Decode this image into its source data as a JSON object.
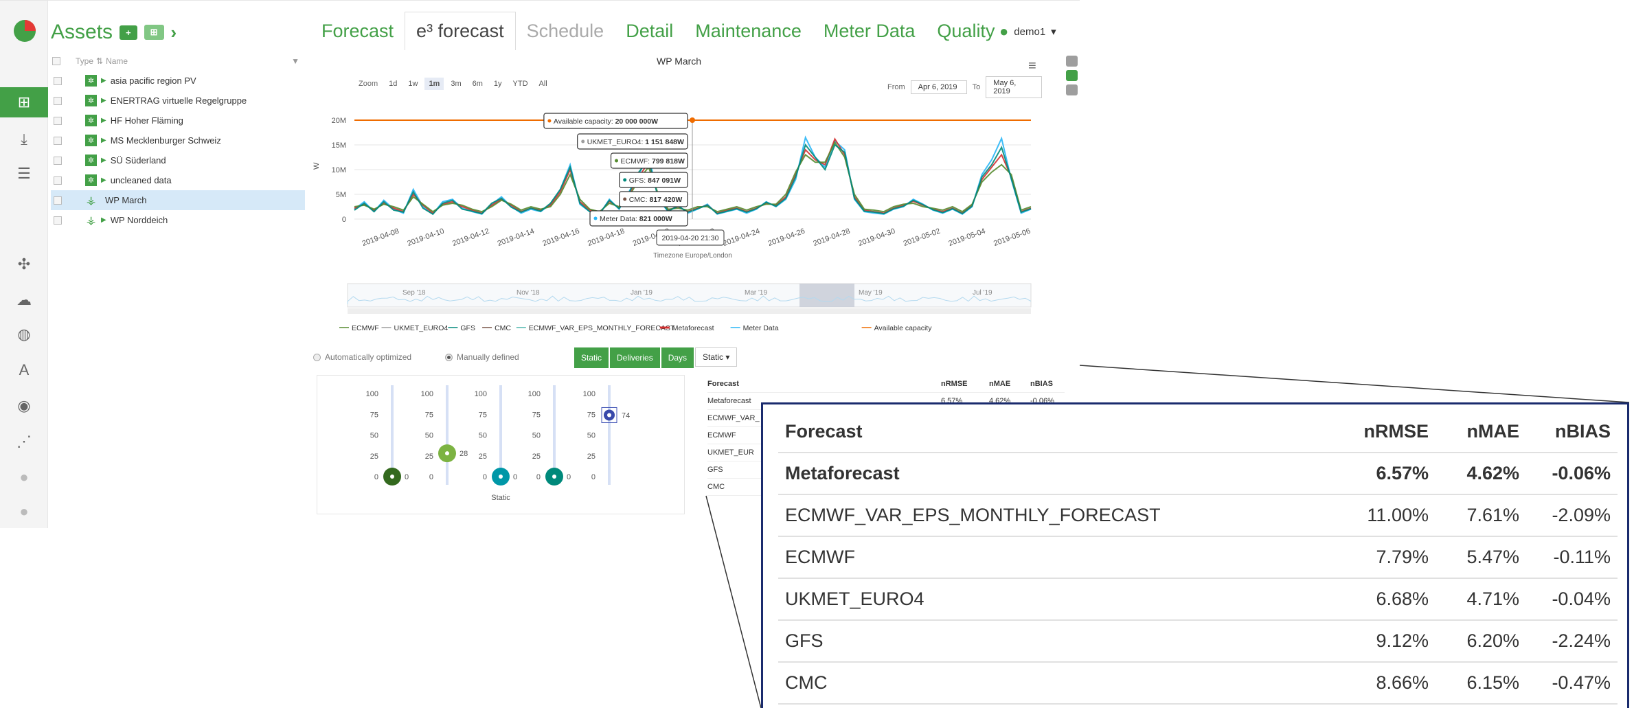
{
  "assets": {
    "title": "Assets",
    "add_label": "+",
    "group_label": "⊞",
    "columns": {
      "type": "Type",
      "name": "Name"
    },
    "items": [
      {
        "label": "asia pacific region PV",
        "kind": "pv",
        "expandable": true
      },
      {
        "label": "ENERTRAG virtuelle Regelgruppe",
        "kind": "pv",
        "expandable": true
      },
      {
        "label": "HF Hoher Fläming",
        "kind": "pv",
        "expandable": true
      },
      {
        "label": "MS Mecklenburger Schweiz",
        "kind": "pv",
        "expandable": true
      },
      {
        "label": "SÜ Süderland",
        "kind": "pv",
        "expandable": true
      },
      {
        "label": "uncleaned data",
        "kind": "pv",
        "expandable": true
      },
      {
        "label": "WP March",
        "kind": "wind",
        "expandable": false,
        "selected": true
      },
      {
        "label": "WP Norddeich",
        "kind": "wind",
        "expandable": true
      }
    ]
  },
  "tabs": [
    {
      "label": "Forecast",
      "state": "normal"
    },
    {
      "label": "e³ forecast",
      "state": "active"
    },
    {
      "label": "Schedule",
      "state": "muted"
    },
    {
      "label": "Detail",
      "state": "normal"
    },
    {
      "label": "Maintenance",
      "state": "normal"
    },
    {
      "label": "Meter Data",
      "state": "normal"
    },
    {
      "label": "Quality",
      "state": "normal"
    }
  ],
  "user": {
    "name": "demo1",
    "caret": "▾"
  },
  "chart": {
    "title": "WP March",
    "zoom_label": "Zoom",
    "zoom_options": [
      "1d",
      "1w",
      "1m",
      "3m",
      "6m",
      "1y",
      "YTD",
      "All"
    ],
    "zoom_active": "1m",
    "from_label": "From",
    "from_value": "Apr 6, 2019",
    "to_label": "To",
    "to_value": "May 6, 2019",
    "timezone_label": "Timezone Europe/London",
    "ylabel": "W"
  },
  "chart_data": {
    "type": "line",
    "title": "WP March",
    "ylabel": "W",
    "xlabel": "Timezone Europe/London",
    "y_ticks": [
      "0",
      "5M",
      "10M",
      "15M",
      "20M"
    ],
    "ylim": [
      0,
      20000000
    ],
    "x_ticks": [
      "2019-04-08",
      "2019-04-10",
      "2019-04-12",
      "2019-04-14",
      "2019-04-16",
      "2019-04-18",
      "2019-04-20",
      "2019-04-22",
      "2019-04-24",
      "2019-04-26",
      "2019-04-28",
      "2019-04-30",
      "2019-05-02",
      "2019-05-04",
      "2019-05-06"
    ],
    "x_days": [
      2,
      4,
      6,
      8,
      10,
      12,
      14,
      16,
      18,
      20,
      22,
      24,
      26,
      28,
      30
    ],
    "days_total": 30,
    "series": [
      {
        "name": "Meter Data",
        "color": "#29b6f6",
        "values": [
          2,
          3.5,
          1.5,
          3.8,
          2,
          1.2,
          6,
          2.5,
          1,
          3.5,
          4,
          2.2,
          1.5,
          1,
          3,
          4.5,
          2.5,
          1.2,
          2,
          1.5,
          3,
          6,
          11,
          3,
          1.5,
          1,
          4,
          2,
          5.5,
          9,
          13,
          4,
          1.5,
          2.8,
          1.2,
          2,
          3,
          1,
          1.5,
          2,
          1.2,
          2,
          3.5,
          2.5,
          4,
          8,
          16.5,
          12.5,
          10.5,
          15.8,
          14,
          4,
          1.5,
          1.2,
          1,
          2,
          2.5,
          4,
          3,
          1.8,
          1.2,
          2,
          1,
          2.5,
          9,
          12,
          16.3,
          8,
          1.2,
          2
        ]
      },
      {
        "name": "Metaforecast",
        "color": "#d32f2f",
        "values": [
          2.2,
          3,
          1.8,
          3.2,
          2.2,
          1.5,
          5,
          2.8,
          1.2,
          3,
          3.5,
          2.5,
          1.8,
          1.2,
          2.8,
          4,
          2.8,
          1.5,
          2.2,
          1.8,
          2.8,
          5.5,
          10,
          3.5,
          1.8,
          1.2,
          3.6,
          2.3,
          5,
          8.5,
          11.5,
          4.5,
          1.8,
          2.5,
          1.5,
          2.2,
          2.8,
          1.2,
          1.8,
          2.2,
          1.5,
          2.2,
          3.2,
          2.8,
          4.5,
          9,
          14,
          12,
          11,
          16.2,
          13,
          4.5,
          1.8,
          1.5,
          1.2,
          2.2,
          2.8,
          3.6,
          2.8,
          2,
          1.5,
          2.2,
          1.2,
          2.8,
          8,
          10.5,
          13,
          8.5,
          1.5,
          2.2
        ]
      },
      {
        "name": "ECMWF",
        "color": "#558b2f",
        "values": [
          2.5,
          2.8,
          2,
          3,
          2.5,
          1.8,
          4.5,
          3,
          1.5,
          2.8,
          3.2,
          2.8,
          2,
          1.5,
          2.5,
          3.8,
          3,
          1.8,
          2.5,
          2,
          2.5,
          5,
          9,
          4,
          2,
          1.5,
          3.2,
          2.5,
          4.5,
          8,
          10.5,
          5,
          2,
          2.2,
          1.8,
          2.5,
          2.5,
          1.5,
          2,
          2.5,
          1.8,
          2.5,
          3,
          3,
          5,
          9.5,
          13,
          11.5,
          11.5,
          15.5,
          12.5,
          5,
          2,
          1.8,
          1.5,
          2.5,
          3,
          3.2,
          2.5,
          2.2,
          1.8,
          2.5,
          1.5,
          3,
          7.5,
          9.5,
          11,
          9,
          1.8,
          2.5
        ]
      },
      {
        "name": "GFS",
        "color": "#00897b",
        "values": [
          1.8,
          3.2,
          1.5,
          3.5,
          1.8,
          1.4,
          5.5,
          2.2,
          1,
          3.2,
          3.8,
          2,
          1.6,
          1.1,
          3.2,
          4.2,
          2.4,
          1.4,
          2.2,
          1.6,
          3.2,
          6,
          10.5,
          3.2,
          1.5,
          1.1,
          3.8,
          2.1,
          5.2,
          9.5,
          12,
          4.2,
          1.6,
          2.6,
          1.4,
          2.1,
          2.8,
          1.1,
          1.6,
          2.1,
          1.4,
          2.1,
          3.4,
          2.6,
          4.2,
          8.5,
          15,
          12.5,
          10,
          15,
          13.5,
          4.2,
          1.6,
          1.4,
          1.1,
          2.1,
          2.6,
          3.8,
          2.9,
          1.9,
          1.3,
          2.1,
          1.1,
          2.6,
          8.5,
          11,
          14.5,
          8.2,
          1.4,
          2.1
        ]
      }
    ],
    "available_capacity": 20000000,
    "tooltip": {
      "items": [
        {
          "label": "Available capacity",
          "value": "20 000 000W",
          "color": "#ef6c00"
        },
        {
          "label": "UKMET_EURO4",
          "value": "1 151 848W",
          "color": "#9e9e9e"
        },
        {
          "label": "ECMWF",
          "value": "799 818W",
          "color": "#558b2f"
        },
        {
          "label": "GFS",
          "value": "847 091W",
          "color": "#00897b"
        },
        {
          "label": "CMC",
          "value": "817 420W",
          "color": "#795548"
        },
        {
          "label": "Meter Data",
          "value": "821 000W",
          "color": "#29b6f6"
        }
      ],
      "time": "2019-04-20 21:30"
    },
    "navigator_labels": [
      "Sep '18",
      "Nov '18",
      "Jan '19",
      "Mar '19",
      "May '19",
      "Jul '19"
    ]
  },
  "legend": [
    {
      "label": "ECMWF",
      "color": "#558b2f"
    },
    {
      "label": "UKMET_EURO4",
      "color": "#9e9e9e"
    },
    {
      "label": "GFS",
      "color": "#00897b"
    },
    {
      "label": "CMC",
      "color": "#795548"
    },
    {
      "label": "ECMWF_VAR_EPS_MONTHLY_FORECAST",
      "color": "#4db6ac"
    },
    {
      "label": "Metaforecast",
      "color": "#d32f2f"
    },
    {
      "label": "Meter Data",
      "color": "#29b6f6"
    },
    {
      "label": "Available capacity",
      "color": "#ef6c00"
    }
  ],
  "weights": {
    "auto_label": "Automatically optimized",
    "manual_label": "Manually defined",
    "buttons": [
      "Static",
      "Deliveries",
      "Days"
    ],
    "select_value": "Static",
    "axis_ticks": [
      "100",
      "75",
      "50",
      "25",
      "0"
    ],
    "sliders": [
      {
        "value": 0,
        "color": "#33691e"
      },
      {
        "value": 28,
        "color": "#7cb342"
      },
      {
        "value": 0,
        "color": "#0097a7"
      },
      {
        "value": 0,
        "color": "#00897b"
      },
      {
        "value": 74,
        "color": "#3949ab"
      }
    ],
    "x_label": "Static"
  },
  "metrics": {
    "headers": [
      "Forecast",
      "nRMSE",
      "nMAE",
      "nBIAS"
    ],
    "rows": [
      {
        "name": "Metaforecast",
        "nrmse": "6.57%",
        "nmae": "4.62%",
        "nbias": "-0.06%"
      },
      {
        "name": "ECMWF_VAR_EPS_MONTHLY_FORECAST",
        "nrmse": "11.00%",
        "nmae": "7.61%",
        "nbias": "-2.09%"
      },
      {
        "name": "ECMWF",
        "nrmse": "7.79%",
        "nmae": "5.47%",
        "nbias": "-0.11%"
      },
      {
        "name": "UKMET_EURO4",
        "nrmse": "6.68%",
        "nmae": "4.71%",
        "nbias": "-0.04%"
      },
      {
        "name": "GFS",
        "nrmse": "9.12%",
        "nmae": "6.20%",
        "nbias": "-2.24%"
      },
      {
        "name": "CMC",
        "nrmse": "8.66%",
        "nmae": "6.15%",
        "nbias": "-0.47%"
      }
    ],
    "small_rows_visible": [
      "Metaforecast",
      "ECMWF_VAR_",
      "ECMWF",
      "UKMET_EUR",
      "GFS",
      "CMC"
    ]
  }
}
